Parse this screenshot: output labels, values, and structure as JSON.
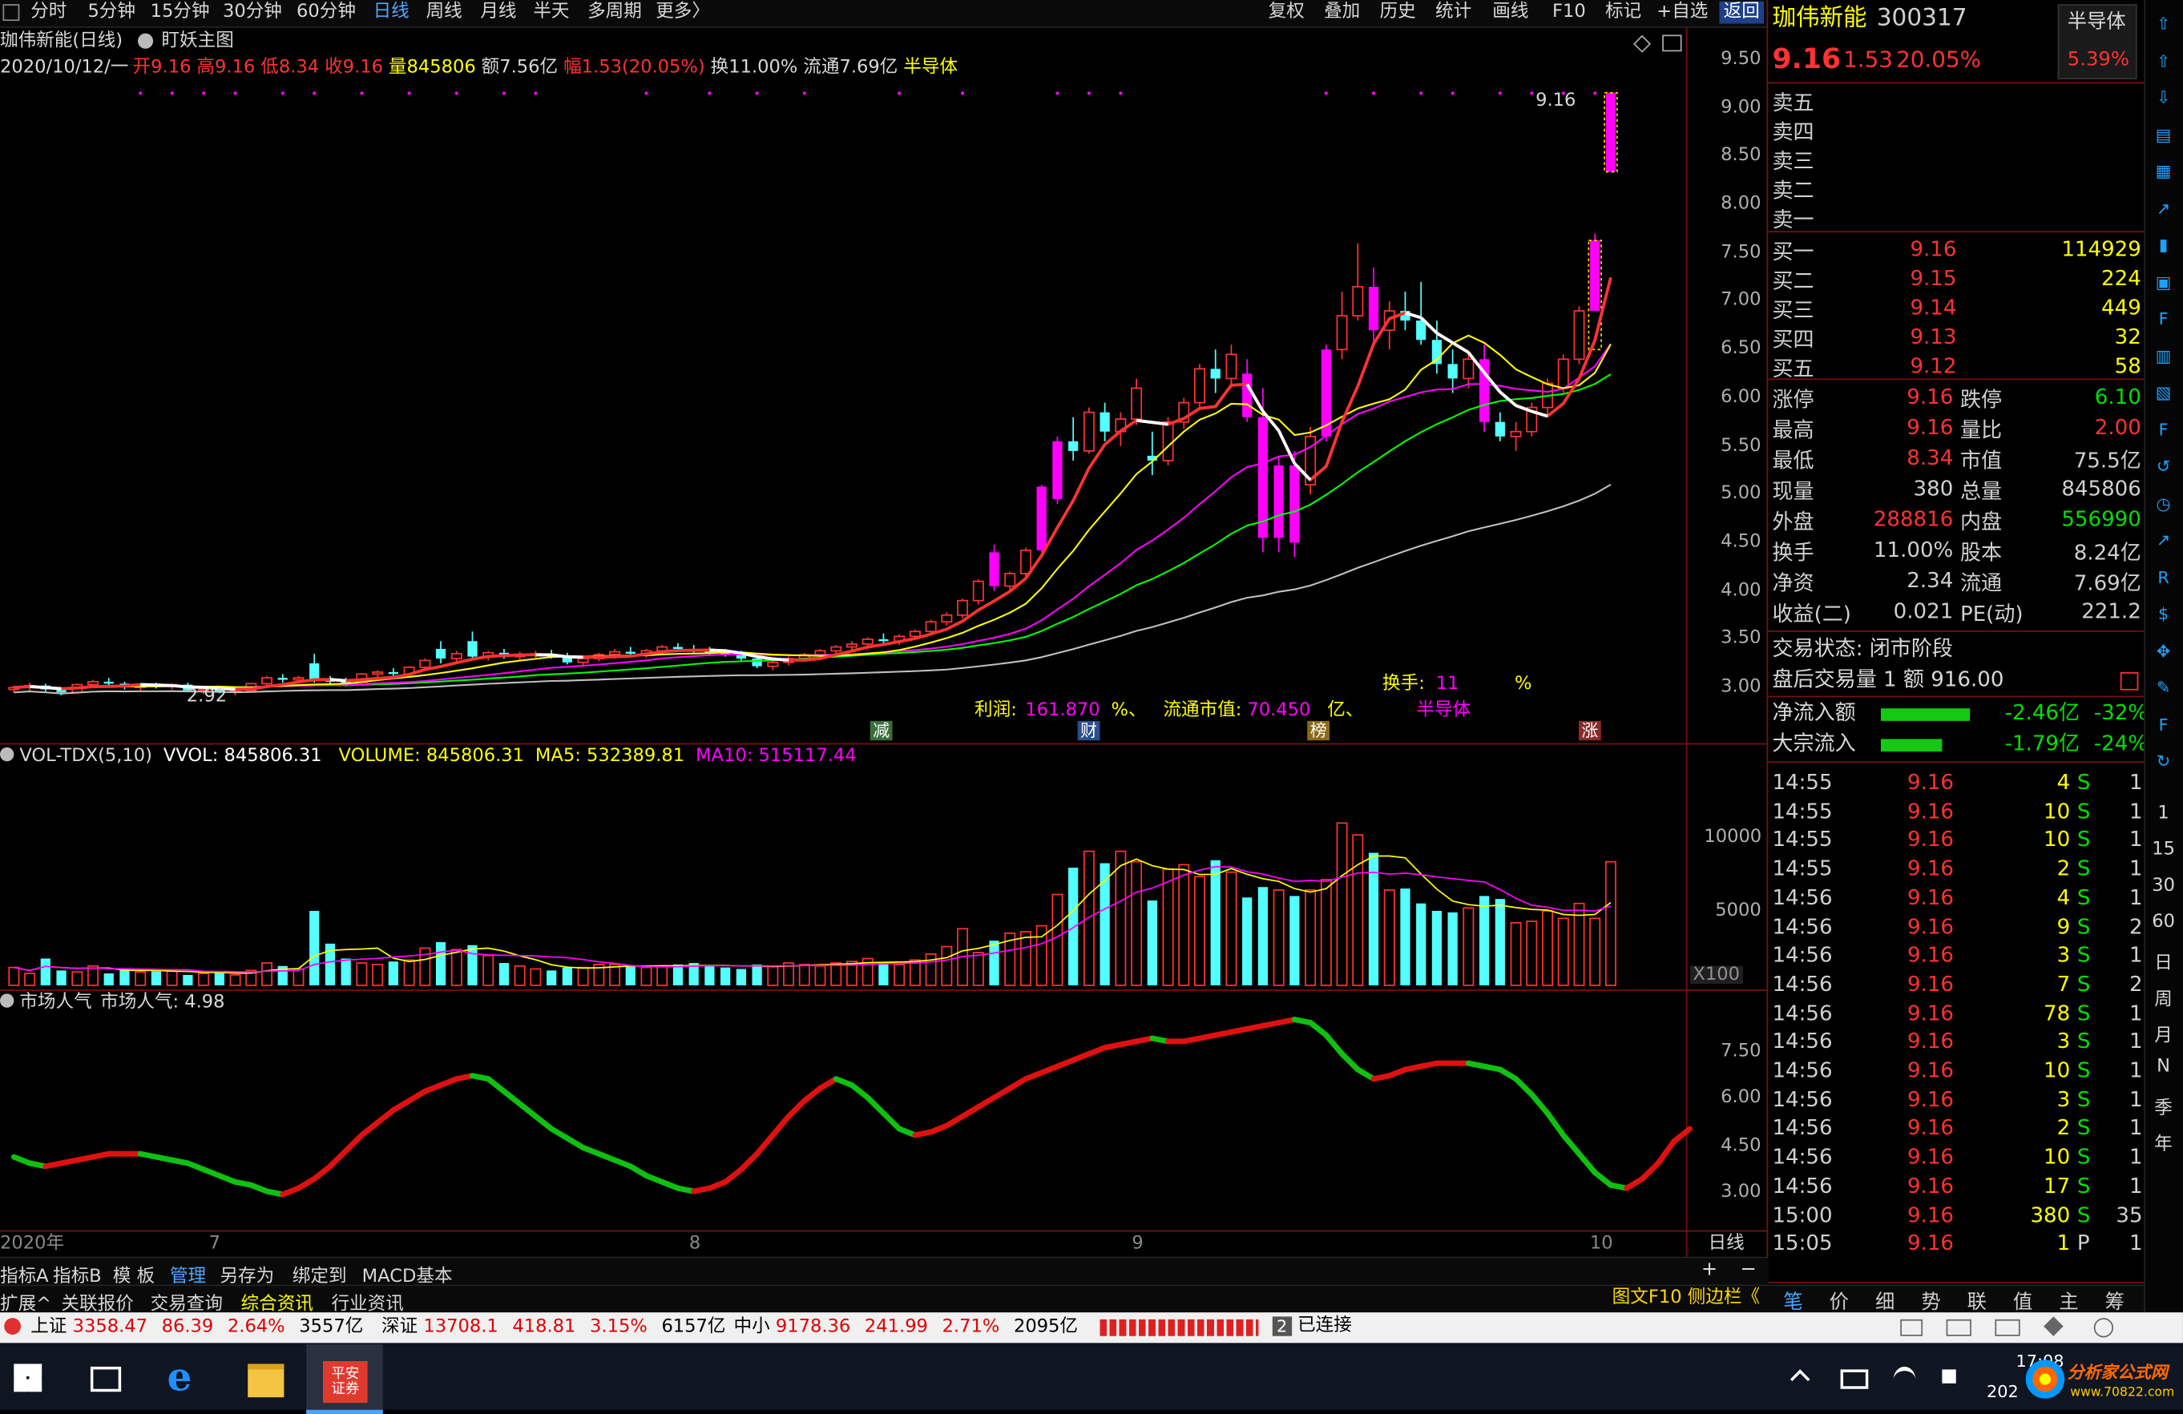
{
  "toolbar": {
    "periods": [
      "分时",
      "5分钟",
      "15分钟",
      "30分钟",
      "60分钟",
      "日线",
      "周线",
      "月线",
      "半天",
      "多周期",
      "更多〉"
    ],
    "active_period": "日线",
    "right_tools": [
      "复权",
      "叠加",
      "历史",
      "统计",
      "画线",
      "F10",
      "标记",
      "+自选",
      "返回"
    ]
  },
  "chart": {
    "title": "珈伟新能(日线)",
    "indicator_name": "盯妖主图",
    "info_date": "2020/10/12/一",
    "info_open": "开9.16",
    "info_high": "高9.16",
    "info_low": "低8.34",
    "info_close": "收9.16",
    "info_vol": "量845806",
    "info_amount": "额7.56亿",
    "info_change": "幅1.53(20.05%)",
    "info_turnover": "换11.00%",
    "info_float": "流通7.69亿",
    "info_sector": "半导体",
    "price_axis": [
      "9.50",
      "9.00",
      "8.50",
      "8.00",
      "7.50",
      "7.00",
      "6.50",
      "6.00",
      "5.50",
      "5.00",
      "4.50",
      "4.00",
      "3.50",
      "3.00"
    ],
    "high_marker": "9.16",
    "low_marker": "2.92",
    "bottom_info_turn_label": "换手:",
    "bottom_info_turn_value": "11",
    "bottom_info_turn_unit": "%",
    "bottom_info_profit_label": "利润:",
    "bottom_info_profit_value": "161.870",
    "bottom_info_profit_unit": "%、",
    "bottom_info_mcap_label": "流通市值:",
    "bottom_info_mcap_value": "70.450",
    "bottom_info_mcap_unit": "亿、",
    "bottom_info_sector": "半导体",
    "tags": [
      "减",
      "财",
      "榜",
      "涨"
    ]
  },
  "chart_data": {
    "type": "candlestick",
    "dates_axis": [
      "2020年",
      "7",
      "8",
      "9",
      "10"
    ],
    "candles": [
      [
        2.98,
        3.02,
        2.95,
        3.0
      ],
      [
        3.0,
        3.05,
        2.97,
        3.02
      ],
      [
        3.02,
        3.04,
        2.96,
        2.98
      ],
      [
        2.98,
        3.0,
        2.92,
        2.95
      ],
      [
        2.95,
        3.04,
        2.94,
        3.03
      ],
      [
        3.03,
        3.08,
        3.0,
        3.06
      ],
      [
        3.06,
        3.1,
        3.02,
        3.04
      ],
      [
        3.04,
        3.06,
        2.98,
        3.0
      ],
      [
        3.0,
        3.03,
        2.97,
        3.02
      ],
      [
        3.02,
        3.05,
        2.99,
        3.01
      ],
      [
        3.01,
        3.04,
        2.98,
        3.03
      ],
      [
        3.03,
        3.05,
        2.96,
        2.97
      ],
      [
        2.97,
        3.0,
        2.93,
        2.98
      ],
      [
        2.98,
        3.01,
        2.94,
        2.96
      ],
      [
        2.96,
        2.99,
        2.92,
        2.97
      ],
      [
        2.97,
        3.05,
        2.96,
        3.04
      ],
      [
        3.04,
        3.12,
        3.02,
        3.1
      ],
      [
        3.1,
        3.14,
        3.05,
        3.08
      ],
      [
        3.08,
        3.12,
        3.04,
        3.1
      ],
      [
        3.25,
        3.35,
        3.05,
        3.08
      ],
      [
        3.08,
        3.12,
        3.02,
        3.06
      ],
      [
        3.06,
        3.1,
        3.01,
        3.03
      ],
      [
        3.03,
        3.15,
        3.02,
        3.14
      ],
      [
        3.14,
        3.18,
        3.09,
        3.16
      ],
      [
        3.16,
        3.2,
        3.12,
        3.14
      ],
      [
        3.14,
        3.22,
        3.13,
        3.21
      ],
      [
        3.21,
        3.3,
        3.18,
        3.28
      ],
      [
        3.4,
        3.48,
        3.25,
        3.3
      ],
      [
        3.3,
        3.38,
        3.26,
        3.35
      ],
      [
        3.48,
        3.58,
        3.3,
        3.32
      ],
      [
        3.32,
        3.38,
        3.28,
        3.36
      ],
      [
        3.36,
        3.4,
        3.3,
        3.32
      ],
      [
        3.32,
        3.37,
        3.28,
        3.34
      ],
      [
        3.34,
        3.38,
        3.31,
        3.35
      ],
      [
        3.35,
        3.39,
        3.3,
        3.32
      ],
      [
        3.32,
        3.36,
        3.24,
        3.26
      ],
      [
        3.26,
        3.32,
        3.22,
        3.3
      ],
      [
        3.3,
        3.36,
        3.27,
        3.34
      ],
      [
        3.34,
        3.4,
        3.3,
        3.37
      ],
      [
        3.37,
        3.42,
        3.33,
        3.35
      ],
      [
        3.35,
        3.4,
        3.31,
        3.38
      ],
      [
        3.38,
        3.44,
        3.35,
        3.42
      ],
      [
        3.42,
        3.46,
        3.38,
        3.4
      ],
      [
        3.4,
        3.44,
        3.36,
        3.38
      ],
      [
        3.38,
        3.42,
        3.34,
        3.36
      ],
      [
        3.36,
        3.4,
        3.32,
        3.34
      ],
      [
        3.34,
        3.38,
        3.28,
        3.3
      ],
      [
        3.3,
        3.34,
        3.2,
        3.22
      ],
      [
        3.22,
        3.28,
        3.18,
        3.26
      ],
      [
        3.26,
        3.32,
        3.23,
        3.3
      ],
      [
        3.3,
        3.36,
        3.27,
        3.34
      ],
      [
        3.34,
        3.4,
        3.3,
        3.38
      ],
      [
        3.38,
        3.44,
        3.35,
        3.42
      ],
      [
        3.42,
        3.48,
        3.39,
        3.45
      ],
      [
        3.45,
        3.52,
        3.42,
        3.5
      ],
      [
        3.5,
        3.56,
        3.46,
        3.48
      ],
      [
        3.48,
        3.55,
        3.44,
        3.53
      ],
      [
        3.53,
        3.6,
        3.5,
        3.58
      ],
      [
        3.58,
        3.7,
        3.55,
        3.68
      ],
      [
        3.68,
        3.78,
        3.64,
        3.75
      ],
      [
        3.75,
        3.92,
        3.72,
        3.9
      ],
      [
        3.9,
        4.12,
        3.86,
        4.1
      ],
      [
        4.4,
        4.48,
        4.0,
        4.05
      ],
      [
        4.05,
        4.2,
        4.0,
        4.18
      ],
      [
        4.18,
        4.45,
        4.15,
        4.42
      ],
      [
        4.42,
        5.1,
        4.4,
        5.08
      ],
      [
        4.95,
        5.6,
        4.9,
        5.55
      ],
      [
        5.55,
        5.8,
        5.35,
        5.45
      ],
      [
        5.45,
        5.9,
        5.42,
        5.85
      ],
      [
        5.85,
        5.95,
        5.55,
        5.65
      ],
      [
        5.65,
        5.85,
        5.5,
        5.78
      ],
      [
        5.78,
        6.2,
        5.72,
        6.1
      ],
      [
        5.4,
        5.65,
        5.2,
        5.35
      ],
      [
        5.35,
        5.8,
        5.3,
        5.75
      ],
      [
        5.75,
        6.0,
        5.68,
        5.95
      ],
      [
        5.95,
        6.35,
        5.9,
        6.3
      ],
      [
        6.3,
        6.5,
        6.05,
        6.2
      ],
      [
        6.2,
        6.55,
        6.1,
        6.45
      ],
      [
        6.25,
        6.4,
        5.75,
        5.8
      ],
      [
        5.8,
        6.1,
        4.4,
        4.55
      ],
      [
        4.55,
        5.4,
        4.4,
        5.3
      ],
      [
        5.3,
        5.45,
        4.35,
        4.5
      ],
      [
        5.1,
        5.7,
        5.0,
        5.6
      ],
      [
        5.6,
        6.55,
        5.55,
        6.5
      ],
      [
        6.5,
        7.1,
        6.4,
        6.85
      ],
      [
        6.85,
        7.6,
        6.8,
        7.15
      ],
      [
        7.15,
        7.35,
        6.55,
        6.7
      ],
      [
        6.7,
        7.0,
        6.5,
        6.9
      ],
      [
        6.9,
        7.1,
        6.7,
        6.8
      ],
      [
        6.8,
        7.2,
        6.55,
        6.6
      ],
      [
        6.6,
        6.8,
        6.25,
        6.35
      ],
      [
        6.35,
        6.5,
        6.05,
        6.2
      ],
      [
        6.2,
        6.45,
        6.1,
        6.4
      ],
      [
        6.4,
        6.55,
        5.65,
        5.75
      ],
      [
        5.75,
        5.85,
        5.55,
        5.6
      ],
      [
        5.6,
        5.75,
        5.45,
        5.65
      ],
      [
        5.65,
        5.95,
        5.6,
        5.9
      ],
      [
        5.9,
        6.2,
        5.8,
        6.15
      ],
      [
        6.1,
        6.45,
        6.05,
        6.4
      ],
      [
        6.4,
        6.95,
        6.35,
        6.9
      ],
      [
        6.9,
        7.7,
        6.9,
        7.63
      ],
      [
        8.34,
        9.16,
        8.34,
        9.16
      ]
    ],
    "ma_legend": "",
    "volume": {
      "title": "VOL-TDX(5,10)",
      "vvol_label": "VVOL: 845806.31",
      "volume_label": "VOLUME: 845806.31",
      "ma5_label": "MA5: 532389.81",
      "ma10_label": "MA10: 515117.44",
      "axis": [
        "10000",
        "5000"
      ],
      "unit": "X100",
      "values": [
        1200,
        800,
        1800,
        1000,
        900,
        1300,
        800,
        1100,
        900,
        950,
        1000,
        700,
        800,
        900,
        700,
        1000,
        1500,
        1300,
        1100,
        5000,
        2800,
        1800,
        1500,
        1400,
        1600,
        1700,
        2500,
        2900,
        2400,
        2700,
        2000,
        1500,
        1300,
        1100,
        1000,
        1200,
        1200,
        1400,
        1400,
        1300,
        1200,
        1300,
        1400,
        1500,
        1300,
        1200,
        1100,
        1400,
        1300,
        1500,
        1400,
        1300,
        1500,
        1600,
        1800,
        1500,
        1400,
        1700,
        2100,
        2600,
        3800,
        2200,
        3000,
        3500,
        3600,
        4000,
        6100,
        7900,
        9000,
        8200,
        9000,
        8300,
        5700,
        7800,
        8100,
        7300,
        8400,
        7600,
        5900,
        6600,
        6400,
        6000,
        6400,
        7100,
        10900,
        10100,
        8900,
        6400,
        6500,
        5500,
        5000,
        4900,
        5200,
        6000,
        5800,
        4200,
        4300,
        5000,
        4500,
        5500,
        4500,
        8300
      ]
    },
    "sentiment": {
      "title": "市场人气",
      "value_label": "市场人气: 4.98",
      "axis": [
        "7.50",
        "6.00",
        "4.50",
        "3.00"
      ],
      "values": [
        4.1,
        3.9,
        3.8,
        3.9,
        4.0,
        4.1,
        4.2,
        4.2,
        4.2,
        4.1,
        4.0,
        3.9,
        3.7,
        3.5,
        3.3,
        3.2,
        3.0,
        2.9,
        3.1,
        3.4,
        3.8,
        4.3,
        4.8,
        5.2,
        5.6,
        5.9,
        6.2,
        6.4,
        6.6,
        6.7,
        6.6,
        6.2,
        5.8,
        5.4,
        5.0,
        4.7,
        4.4,
        4.2,
        4.0,
        3.8,
        3.5,
        3.3,
        3.1,
        3.0,
        3.1,
        3.3,
        3.7,
        4.2,
        4.8,
        5.4,
        5.9,
        6.3,
        6.6,
        6.4,
        6.0,
        5.5,
        5.0,
        4.8,
        4.9,
        5.1,
        5.4,
        5.7,
        6.0,
        6.3,
        6.6,
        6.8,
        7.0,
        7.2,
        7.4,
        7.6,
        7.7,
        7.8,
        7.9,
        7.8,
        7.8,
        7.9,
        8.0,
        8.1,
        8.2,
        8.3,
        8.4,
        8.5,
        8.4,
        8.0,
        7.4,
        6.9,
        6.6,
        6.7,
        6.9,
        7.0,
        7.1,
        7.1,
        7.1,
        7.0,
        6.9,
        6.6,
        6.1,
        5.5,
        4.8,
        4.2,
        3.6,
        3.2,
        3.1,
        3.4,
        3.9,
        4.6,
        5.0
      ]
    }
  },
  "quote": {
    "name": "珈伟新能",
    "code": "300317",
    "sector_btn": "半导体",
    "sector_pct": "5.39%",
    "price": "9.16",
    "change": "1.53",
    "pct": "20.05%",
    "sells": [
      {
        "label": "卖五"
      },
      {
        "label": "卖四"
      },
      {
        "label": "卖三"
      },
      {
        "label": "卖二"
      },
      {
        "label": "卖一"
      }
    ],
    "buys": [
      {
        "label": "买一",
        "price": "9.16",
        "vol": "114929"
      },
      {
        "label": "买二",
        "price": "9.15",
        "vol": "224"
      },
      {
        "label": "买三",
        "price": "9.14",
        "vol": "449"
      },
      {
        "label": "买四",
        "price": "9.13",
        "vol": "32"
      },
      {
        "label": "买五",
        "price": "9.12",
        "vol": "58"
      }
    ],
    "stats": [
      {
        "l1": "涨停",
        "v1": "9.16",
        "l2": "跌停",
        "v2": "6.10"
      },
      {
        "l1": "最高",
        "v1": "9.16",
        "l2": "量比",
        "v2": "2.00"
      },
      {
        "l1": "最低",
        "v1": "8.34",
        "l2": "市值",
        "v2": "75.5亿"
      },
      {
        "l1": "现量",
        "v1": "380",
        "l2": "总量",
        "v2": "845806"
      },
      {
        "l1": "外盘",
        "v1": "288816",
        "l2": "内盘",
        "v2": "556990"
      },
      {
        "l1": "换手",
        "v1": "11.00%",
        "l2": "股本",
        "v2": "8.24亿"
      },
      {
        "l1": "净资",
        "v1": "2.34",
        "l2": "流通",
        "v2": "7.69亿"
      },
      {
        "l1": "收益(二)",
        "v1": "0.021",
        "l2": "PE(动)",
        "v2": "221.2"
      }
    ],
    "trade_status": "交易状态: 闭市阶段",
    "after_hours": "盘后交易量 1 额 916.00",
    "net_inflow_label": "净流入额",
    "net_inflow_value": "-2.46亿",
    "net_inflow_pct": "-32%",
    "big_inflow_label": "大宗流入",
    "big_inflow_value": "-1.79亿",
    "big_inflow_pct": "-24%",
    "ticks": [
      {
        "t": "14:55",
        "p": "9.16",
        "v": "4",
        "s": "S",
        "n": "1"
      },
      {
        "t": "14:55",
        "p": "9.16",
        "v": "10",
        "s": "S",
        "n": "1"
      },
      {
        "t": "14:55",
        "p": "9.16",
        "v": "10",
        "s": "S",
        "n": "1"
      },
      {
        "t": "14:55",
        "p": "9.16",
        "v": "2",
        "s": "S",
        "n": "1"
      },
      {
        "t": "14:56",
        "p": "9.16",
        "v": "4",
        "s": "S",
        "n": "1"
      },
      {
        "t": "14:56",
        "p": "9.16",
        "v": "9",
        "s": "S",
        "n": "2"
      },
      {
        "t": "14:56",
        "p": "9.16",
        "v": "3",
        "s": "S",
        "n": "1"
      },
      {
        "t": "14:56",
        "p": "9.16",
        "v": "7",
        "s": "S",
        "n": "2"
      },
      {
        "t": "14:56",
        "p": "9.16",
        "v": "78",
        "s": "S",
        "n": "1"
      },
      {
        "t": "14:56",
        "p": "9.16",
        "v": "3",
        "s": "S",
        "n": "1"
      },
      {
        "t": "14:56",
        "p": "9.16",
        "v": "10",
        "s": "S",
        "n": "1"
      },
      {
        "t": "14:56",
        "p": "9.16",
        "v": "3",
        "s": "S",
        "n": "1"
      },
      {
        "t": "14:56",
        "p": "9.16",
        "v": "2",
        "s": "S",
        "n": "1"
      },
      {
        "t": "14:56",
        "p": "9.16",
        "v": "10",
        "s": "S",
        "n": "1"
      },
      {
        "t": "14:56",
        "p": "9.16",
        "v": "17",
        "s": "S",
        "n": "1"
      },
      {
        "t": "15:00",
        "p": "9.16",
        "v": "380",
        "s": "S",
        "n": "35"
      },
      {
        "t": "15:05",
        "p": "9.16",
        "v": "1",
        "s": "P",
        "n": "1"
      }
    ],
    "bottom_tabs": [
      "笔",
      "价",
      "细",
      "势",
      "联",
      "值",
      "主",
      "筹"
    ]
  },
  "sidebar": {
    "labels": [
      "1",
      "15",
      "30",
      "60",
      "日",
      "周",
      "月",
      "N",
      "季",
      "年"
    ]
  },
  "bottom_bar": {
    "row1": [
      "指标A",
      "指标B",
      "模 板",
      "管理",
      "另存为",
      "绑定到",
      "MACD基本"
    ],
    "row1_period": "日线",
    "row2": [
      "扩展^",
      "关联报价",
      "交易查询",
      "综合资讯",
      "行业资讯"
    ],
    "row2_right": "图文F10 侧边栏《"
  },
  "status": {
    "sh_label": "上证",
    "sh_val": "3358.47",
    "sh_chg": "86.39",
    "sh_pct": "2.64%",
    "sh_amt": "3557亿",
    "sz_label": "深证",
    "sz_val": "13708.1",
    "sz_chg": "418.81",
    "sz_pct": "3.15%",
    "sz_amt": "6157亿",
    "zx_label": "中小",
    "zx_val": "9178.36",
    "zx_chg": "241.99",
    "zx_pct": "2.71%",
    "zx_amt": "2095亿",
    "conn_num": "2",
    "conn_text": "已连接"
  },
  "taskbar": {
    "app_label": "平安证券",
    "clock_time": "17:08",
    "clock_date": "202",
    "watermark": "分析家公式网",
    "watermark_url": "www.70822.com"
  },
  "colors": {
    "up": "#ff3232",
    "down": "#54ffff",
    "magenta": "#ff00ff",
    "yellow": "#ffff00",
    "white_ma": "#ffffff",
    "green_ma": "#00ff00",
    "gray_ma": "#c0c0c0",
    "panel_border": "#7a1010"
  }
}
